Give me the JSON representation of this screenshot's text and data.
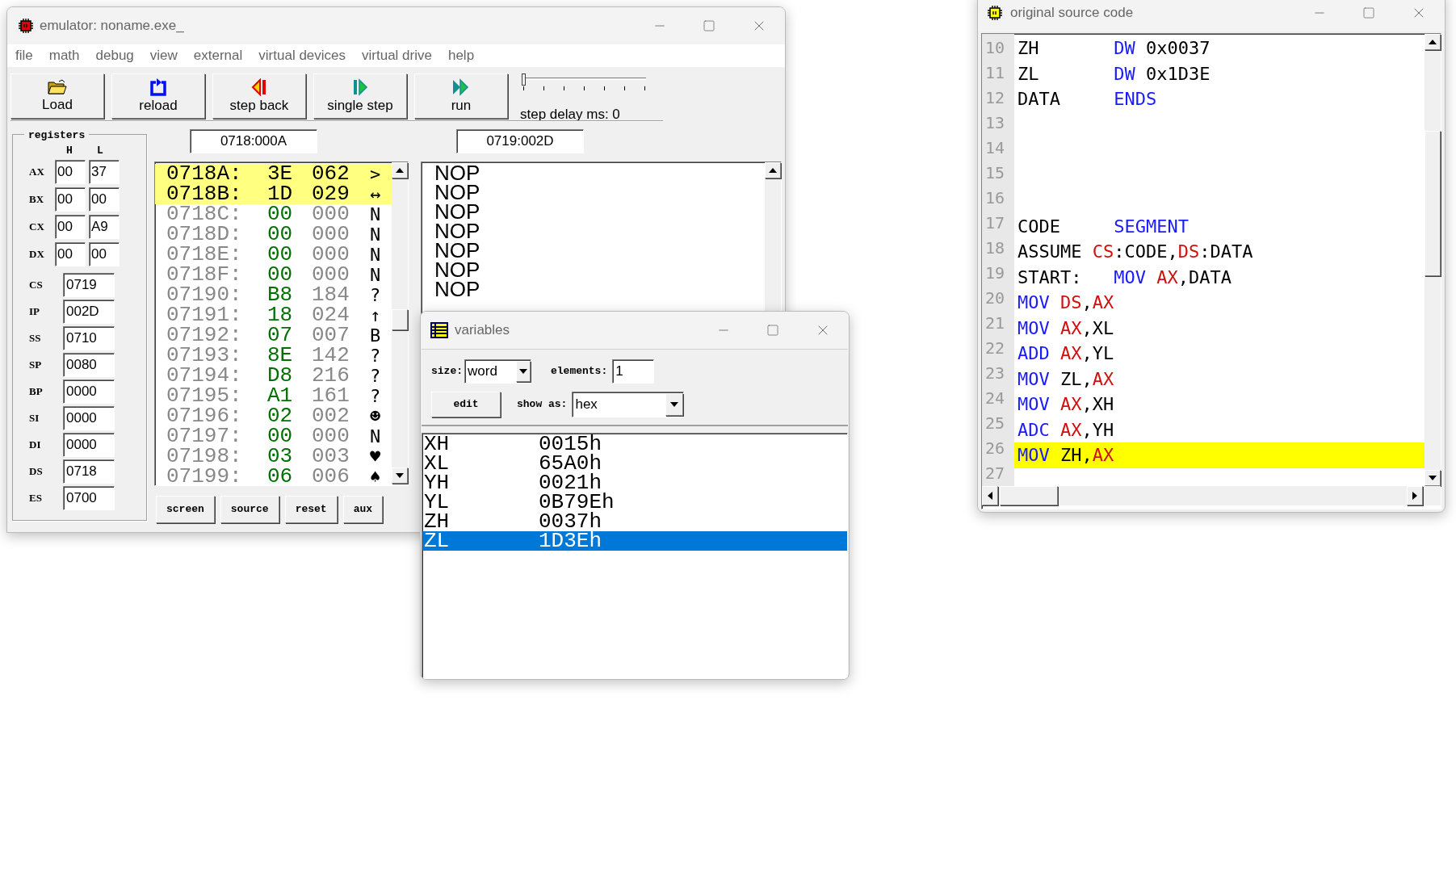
{
  "emulator": {
    "title": "emulator: noname.exe_",
    "menu": [
      "file",
      "math",
      "debug",
      "view",
      "external",
      "virtual devices",
      "virtual drive",
      "help"
    ],
    "toolbar": [
      {
        "label": "Load",
        "kind": "load"
      },
      {
        "label": "reload",
        "kind": "reload"
      },
      {
        "label": "step back",
        "kind": "step_back"
      },
      {
        "label": "single step",
        "kind": "single_step"
      },
      {
        "label": "run",
        "kind": "run"
      }
    ],
    "step_delay": {
      "label": "step delay ms: 0",
      "level": 0
    },
    "registers": {
      "title": "registers",
      "high_label": "H",
      "low_label": "L",
      "pairs": [
        {
          "name": "AX",
          "high": "00",
          "low": "37"
        },
        {
          "name": "BX",
          "high": "00",
          "low": "00"
        },
        {
          "name": "CX",
          "high": "00",
          "low": "A9"
        },
        {
          "name": "DX",
          "high": "00",
          "low": "00"
        }
      ],
      "words": [
        {
          "name": "CS",
          "value": "0719"
        },
        {
          "name": "IP",
          "value": "002D"
        },
        {
          "name": "SS",
          "value": "0710"
        },
        {
          "name": "SP",
          "value": "0080"
        },
        {
          "name": "BP",
          "value": "0000"
        },
        {
          "name": "SI",
          "value": "0000"
        },
        {
          "name": "DI",
          "value": "0000"
        },
        {
          "name": "DS",
          "value": "0718"
        },
        {
          "name": "ES",
          "value": "0700"
        }
      ]
    },
    "memory_address": "0718:000A",
    "memory_rows": [
      {
        "address": "0718A:",
        "hex": "3E",
        "dec": "062",
        "char": ">",
        "selected": true
      },
      {
        "address": "0718B:",
        "hex": "1D",
        "dec": "029",
        "char": "↔",
        "selected": true
      },
      {
        "address": "0718C:",
        "hex": "00",
        "dec": "000",
        "char": "N",
        "selected": false
      },
      {
        "address": "0718D:",
        "hex": "00",
        "dec": "000",
        "char": "N",
        "selected": false
      },
      {
        "address": "0718E:",
        "hex": "00",
        "dec": "000",
        "char": "N",
        "selected": false
      },
      {
        "address": "0718F:",
        "hex": "00",
        "dec": "000",
        "char": "N",
        "selected": false
      },
      {
        "address": "07190:",
        "hex": "B8",
        "dec": "184",
        "char": "?",
        "selected": false
      },
      {
        "address": "07191:",
        "hex": "18",
        "dec": "024",
        "char": "↑",
        "selected": false
      },
      {
        "address": "07192:",
        "hex": "07",
        "dec": "007",
        "char": "B",
        "selected": false
      },
      {
        "address": "07193:",
        "hex": "8E",
        "dec": "142",
        "char": "?",
        "selected": false
      },
      {
        "address": "07194:",
        "hex": "D8",
        "dec": "216",
        "char": "?",
        "selected": false
      },
      {
        "address": "07195:",
        "hex": "A1",
        "dec": "161",
        "char": "?",
        "selected": false
      },
      {
        "address": "07196:",
        "hex": "02",
        "dec": "002",
        "char": "☻",
        "selected": false
      },
      {
        "address": "07197:",
        "hex": "00",
        "dec": "000",
        "char": "N",
        "selected": false
      },
      {
        "address": "07198:",
        "hex": "03",
        "dec": "003",
        "char": "♥",
        "selected": false
      },
      {
        "address": "07199:",
        "hex": "06",
        "dec": "006",
        "char": "♠",
        "selected": false
      }
    ],
    "disassembly_address": "0719:002D",
    "disassembly_rows": [
      "NOP",
      "NOP",
      "NOP",
      "NOP",
      "NOP",
      "NOP",
      "NOP"
    ],
    "bottom_buttons": [
      "screen",
      "source",
      "reset",
      "aux"
    ]
  },
  "variables": {
    "title": "variables",
    "size_label": "size:",
    "size_value": "word",
    "elements_label": "elements:",
    "elements_value": "1",
    "edit_button": "edit",
    "show_as_label": "show as:",
    "show_as_value": "hex",
    "rows": [
      {
        "name": "XH",
        "value": "0015h",
        "selected": false
      },
      {
        "name": "XL",
        "value": "65A0h",
        "selected": false
      },
      {
        "name": "YH",
        "value": "0021h",
        "selected": false
      },
      {
        "name": "YL",
        "value": "0B79Eh",
        "selected": false
      },
      {
        "name": "ZH",
        "value": "0037h",
        "selected": false
      },
      {
        "name": "ZL",
        "value": "1D3Eh",
        "selected": true
      }
    ]
  },
  "source": {
    "title": "original source code",
    "lines": [
      {
        "number": "10",
        "selected": false,
        "tokens": [
          {
            "text": "ZH       ",
            "kind": "plain"
          },
          {
            "text": "DW",
            "kind": "keyword"
          },
          {
            "text": " 0x0037",
            "kind": "plain"
          }
        ]
      },
      {
        "number": "11",
        "selected": false,
        "tokens": [
          {
            "text": "ZL       ",
            "kind": "plain"
          },
          {
            "text": "DW",
            "kind": "keyword"
          },
          {
            "text": " 0x1D3E",
            "kind": "plain"
          }
        ]
      },
      {
        "number": "12",
        "selected": false,
        "tokens": [
          {
            "text": "DATA     ",
            "kind": "plain"
          },
          {
            "text": "ENDS",
            "kind": "keyword"
          }
        ]
      },
      {
        "number": "13",
        "selected": false
      },
      {
        "number": "14",
        "selected": false
      },
      {
        "number": "15",
        "selected": false
      },
      {
        "number": "16",
        "selected": false
      },
      {
        "number": "17",
        "selected": false,
        "tokens": [
          {
            "text": "CODE     ",
            "kind": "plain"
          },
          {
            "text": "SEGMENT",
            "kind": "keyword"
          }
        ]
      },
      {
        "number": "18",
        "selected": false,
        "tokens": [
          {
            "text": "ASSUME ",
            "kind": "plain"
          },
          {
            "text": "CS",
            "kind": "register"
          },
          {
            "text": ":CODE,",
            "kind": "plain"
          },
          {
            "text": "DS",
            "kind": "register"
          },
          {
            "text": ":DATA",
            "kind": "plain"
          }
        ]
      },
      {
        "number": "19",
        "selected": false,
        "tokens": [
          {
            "text": "START:   ",
            "kind": "plain"
          },
          {
            "text": "MOV ",
            "kind": "keyword"
          },
          {
            "text": "AX",
            "kind": "register"
          },
          {
            "text": ",DATA",
            "kind": "plain"
          }
        ]
      },
      {
        "number": "20",
        "selected": false,
        "tokens": [
          {
            "text": "MOV ",
            "kind": "keyword"
          },
          {
            "text": "DS",
            "kind": "register"
          },
          {
            "text": ",",
            "kind": "plain"
          },
          {
            "text": "AX",
            "kind": "register"
          }
        ]
      },
      {
        "number": "21",
        "selected": false,
        "tokens": [
          {
            "text": "MOV ",
            "kind": "keyword"
          },
          {
            "text": "AX",
            "kind": "register"
          },
          {
            "text": ",XL",
            "kind": "plain"
          }
        ]
      },
      {
        "number": "22",
        "selected": false,
        "tokens": [
          {
            "text": "ADD ",
            "kind": "keyword"
          },
          {
            "text": "AX",
            "kind": "register"
          },
          {
            "text": ",YL",
            "kind": "plain"
          }
        ]
      },
      {
        "number": "23",
        "selected": false,
        "tokens": [
          {
            "text": "MOV",
            "kind": "keyword"
          },
          {
            "text": " ZL,",
            "kind": "plain"
          },
          {
            "text": "AX",
            "kind": "register"
          }
        ]
      },
      {
        "number": "24",
        "selected": false,
        "tokens": [
          {
            "text": "MOV ",
            "kind": "keyword"
          },
          {
            "text": "AX",
            "kind": "register"
          },
          {
            "text": ",XH",
            "kind": "plain"
          }
        ]
      },
      {
        "number": "25",
        "selected": false,
        "tokens": [
          {
            "text": "ADC ",
            "kind": "keyword"
          },
          {
            "text": "AX",
            "kind": "register"
          },
          {
            "text": ",YH",
            "kind": "plain"
          }
        ]
      },
      {
        "number": "26",
        "selected": true,
        "tokens": [
          {
            "text": "MOV",
            "kind": "keyword"
          },
          {
            "text": " ZH,",
            "kind": "plain"
          },
          {
            "text": "AX",
            "kind": "register"
          }
        ]
      },
      {
        "number": "27",
        "selected": false
      }
    ]
  }
}
